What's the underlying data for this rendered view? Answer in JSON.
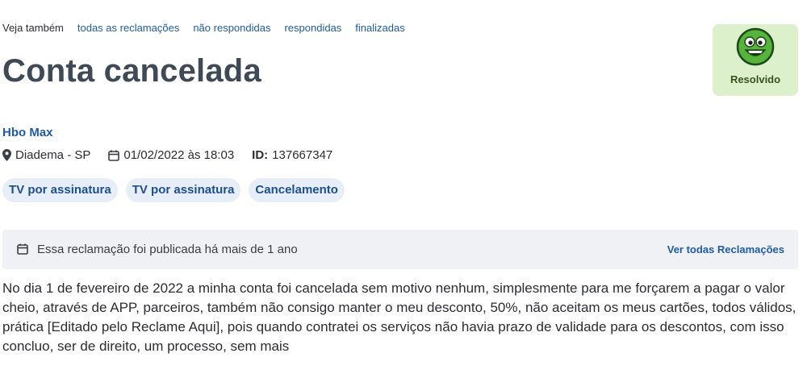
{
  "nav": {
    "lead": "Veja também",
    "links": [
      "todas as reclamações",
      "não respondidas",
      "respondidas",
      "finalizadas"
    ]
  },
  "title": "Conta cancelada",
  "status": {
    "label": "Resolvido",
    "icon": "happy-face-icon",
    "color": "#ddf0cc"
  },
  "company": "Hbo Max",
  "meta": {
    "location": "Diadema - SP",
    "datetime": "01/02/2022 às 18:03",
    "id_label": "ID:",
    "id_value": "137667347"
  },
  "tags": [
    "TV por assinatura",
    "TV por assinatura",
    "Cancelamento"
  ],
  "notice": {
    "text": "Essa reclamação foi publicada há mais de 1 ano",
    "link": "Ver todas Reclamações"
  },
  "complaint_text": "No dia 1 de fevereiro de 2022 a minha conta foi cancelada sem motivo nenhum, simplesmente para me forçarem a pagar o valor cheio, através de APP, parceiros, também não consigo manter o meu desconto, 50%, não aceitam os meus cartões, todos válidos, prática [Editado pelo Reclame Aqui], pois quando contratei os serviços não havia prazo de validade para os descontos, com isso concluo, ser de direito, um processo, sem mais"
}
